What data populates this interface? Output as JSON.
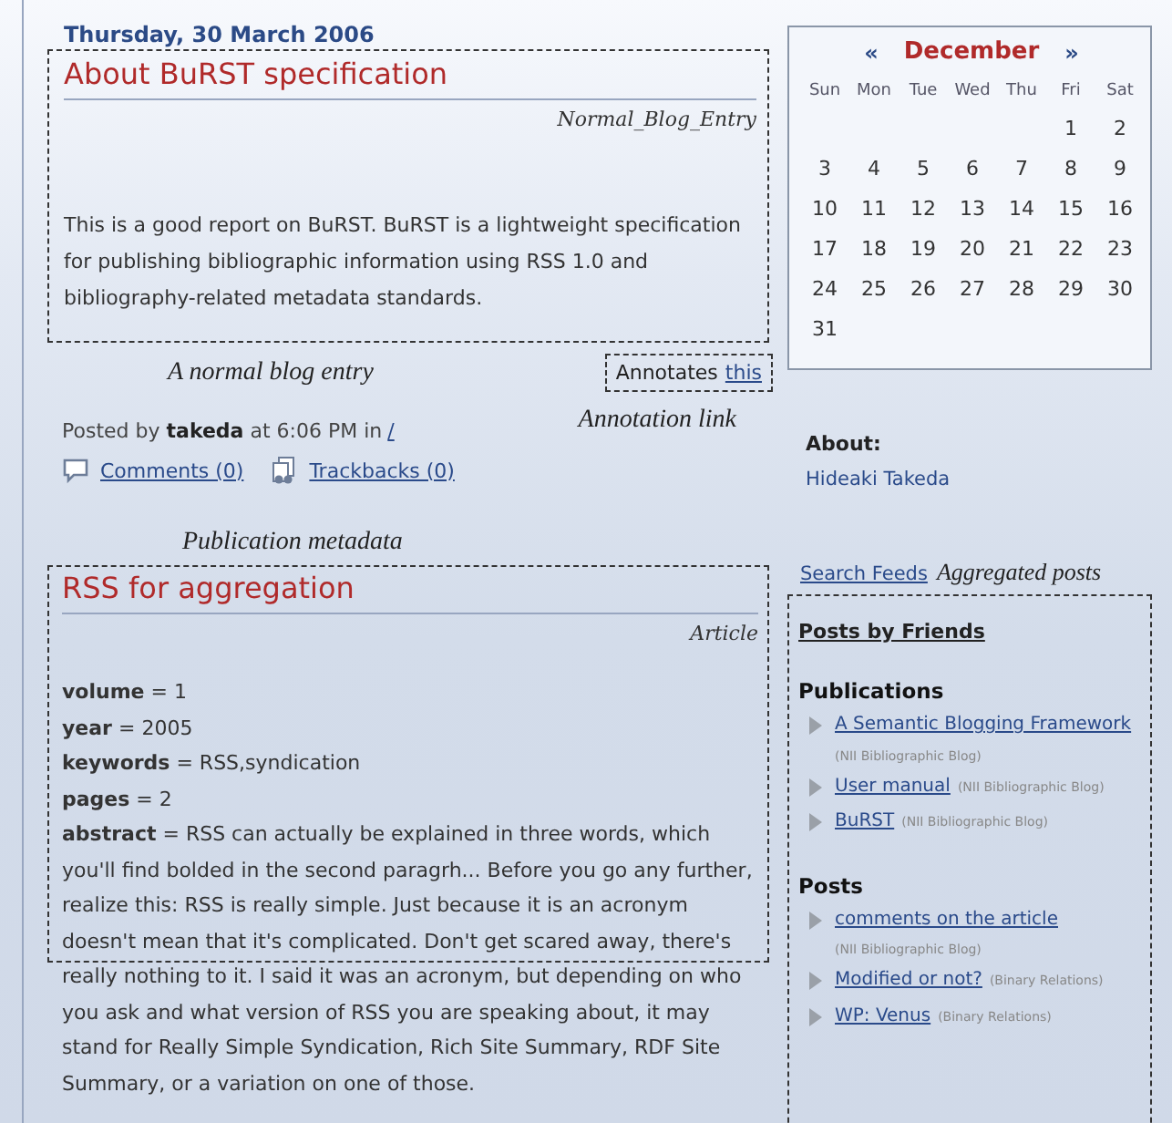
{
  "date": "Thursday, 30 March 2006",
  "blog_entry": {
    "title": "About BuRST specification",
    "type_label": "Normal_Blog_Entry",
    "body": "This is a good report on BuRST. BuRST is a lightweight specification for publishing bibliographic information using RSS 1.0 and bibliography-related metadata standards."
  },
  "entry_note": "A normal blog entry",
  "annotation": {
    "text": "Annotates",
    "link": "this",
    "note": "Annotation link"
  },
  "post_meta": {
    "prefix": "Posted by",
    "author": "takeda",
    "middle": "at 6:06 PM in",
    "category": "/",
    "comments": "Comments (0)",
    "trackbacks": "Trackbacks (0)"
  },
  "publication_note": "Publication metadata",
  "publication": {
    "title": "RSS for aggregation",
    "type_label": "Article",
    "fields": [
      "**volume** = 1",
      "**year** = 2005",
      "**keywords** = RSS,syndication",
      "**pages** = 2",
      "**abstract** = RSS can actually be explained in three words, which you'll find bolded in the second paragrh... Before you go any further, realize this: RSS is really simple. Just because it is an acronym doesn't mean that it's complicated. Don't get scared away, there's really nothing to it. I said it was an acronym, but depending on who you ask and what version of RSS you are speaking about, it may stand for Really Simple Syndication, Rich Site Summary, RDF Site Summary, or a variation on one of those."
    ]
  },
  "calendar": {
    "prev": "«",
    "month": "December",
    "next": "»",
    "weekdays": [
      "Sun",
      "Mon",
      "Tue",
      "Wed",
      "Thu",
      "Fri",
      "Sat"
    ],
    "weeks": [
      {
        "kind": "leading",
        "days": [
          "1",
          "2"
        ]
      },
      {
        "kind": "regular",
        "days": [
          "3",
          "4",
          "5",
          "6",
          "7",
          "8",
          "9"
        ]
      },
      {
        "kind": "regular",
        "days": [
          "10",
          "11",
          "12",
          "13",
          "14",
          "15",
          "16"
        ]
      },
      {
        "kind": "regular",
        "days": [
          "17",
          "18",
          "19",
          "20",
          "21",
          "22",
          "23"
        ]
      },
      {
        "kind": "regular",
        "days": [
          "24",
          "25",
          "26",
          "27",
          "28",
          "29",
          "30"
        ]
      },
      {
        "kind": "regular",
        "days": [
          "31"
        ]
      }
    ]
  },
  "about": {
    "heading": "About:",
    "name": "Hideaki Takeda"
  },
  "search_feeds": "Search Feeds",
  "aggregated_note": "Aggregated posts",
  "friends": {
    "title": "Posts by Friends",
    "sections": [
      {
        "heading": "Publications",
        "items": [
          {
            "title": "A Semantic Blogging Framework",
            "source": "(NII Bibliographic Blog)"
          },
          {
            "title": "User manual",
            "source": "(NII Bibliographic Blog)"
          },
          {
            "title": "BuRST",
            "source": "(NII Bibliographic Blog)"
          }
        ]
      },
      {
        "heading": "Posts",
        "items": [
          {
            "title": "comments on the article",
            "source": "(NII Bibliographic Blog)"
          },
          {
            "title": "Modified or not?",
            "source": "(Binary Relations)"
          },
          {
            "title": "WP: Venus",
            "source": "(Binary Relations)"
          }
        ]
      }
    ]
  }
}
